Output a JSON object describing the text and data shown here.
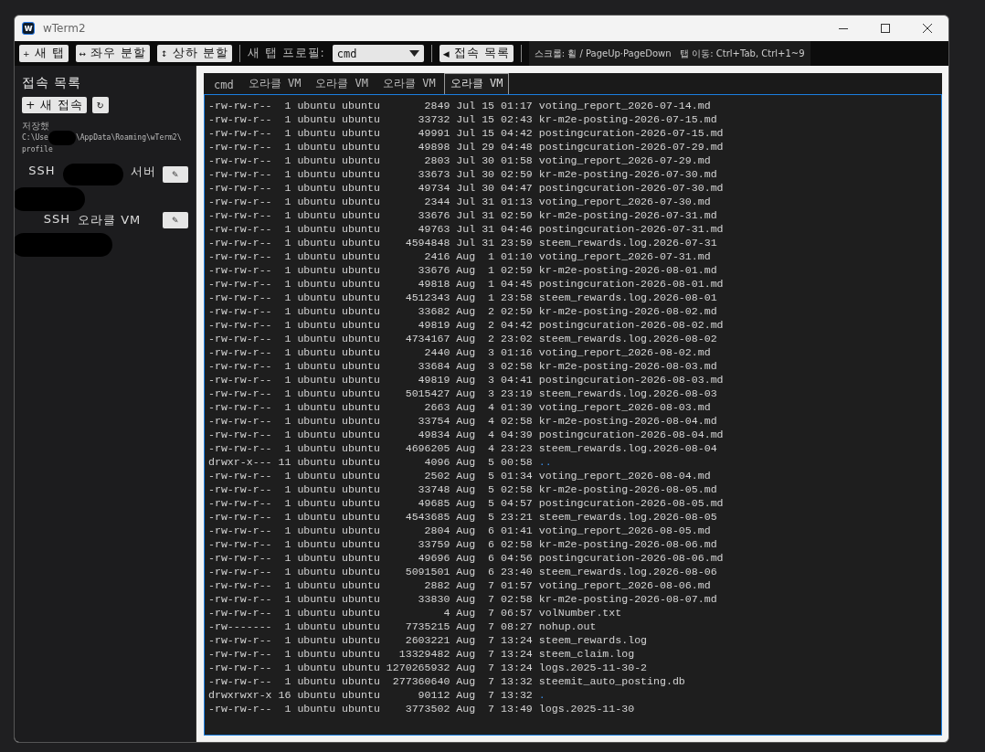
{
  "window": {
    "icon_letter": "w",
    "title": "wTerm2"
  },
  "toolbar": {
    "buttons": [
      {
        "icon": "+",
        "label": "새 탭"
      },
      {
        "icon": "↔",
        "label": "좌우 분할"
      },
      {
        "icon": "↕",
        "label": "상하 분할"
      }
    ],
    "profile_label": "새 탭 프로필:",
    "profile_value": "cmd",
    "connections_button": {
      "icon": "◀",
      "label": "접속 목록"
    },
    "hint": "스크롤: 휠 / PageUp·PageDown   탭 이동: Ctrl+Tab, Ctrl+1~9"
  },
  "sidebar": {
    "title": "접속 목록",
    "new_button": "+ 새 접속",
    "refresh_button": "↻",
    "saved_label": "저장했",
    "saved_path_parts": [
      "C:\\Use",
      "\\AppData\\Roaming\\wTerm2\\",
      "profile"
    ],
    "connections": [
      {
        "protocol": "SSH",
        "label": "서버",
        "redacted": true,
        "edit": "✎"
      },
      {
        "protocol": "SSH",
        "label": "오라클 VM",
        "redacted": false,
        "edit": "✎"
      }
    ]
  },
  "tabs": [
    {
      "label": "cmd",
      "selected": false
    },
    {
      "label": "오라클 VM",
      "selected": false
    },
    {
      "label": "오라클 VM",
      "selected": false
    },
    {
      "label": "오라클 VM",
      "selected": false
    },
    {
      "label": "오라클 VM",
      "selected": true
    }
  ],
  "terminal_lines": [
    {
      "info": "-rw-rw-r--  1 ubuntu ubuntu       2849 Jul 15 01:17",
      "name": "voting_report_2026-07-14.md",
      "kind": "file"
    },
    {
      "info": "-rw-rw-r--  1 ubuntu ubuntu      33732 Jul 15 02:43",
      "name": "kr-m2e-posting-2026-07-15.md",
      "kind": "file"
    },
    {
      "info": "-rw-rw-r--  1 ubuntu ubuntu      49991 Jul 15 04:42",
      "name": "postingcuration-2026-07-15.md",
      "kind": "file"
    },
    {
      "info": "-rw-rw-r--  1 ubuntu ubuntu      49898 Jul 29 04:48",
      "name": "postingcuration-2026-07-29.md",
      "kind": "file"
    },
    {
      "info": "-rw-rw-r--  1 ubuntu ubuntu       2803 Jul 30 01:58",
      "name": "voting_report_2026-07-29.md",
      "kind": "file"
    },
    {
      "info": "-rw-rw-r--  1 ubuntu ubuntu      33673 Jul 30 02:59",
      "name": "kr-m2e-posting-2026-07-30.md",
      "kind": "file"
    },
    {
      "info": "-rw-rw-r--  1 ubuntu ubuntu      49734 Jul 30 04:47",
      "name": "postingcuration-2026-07-30.md",
      "kind": "file"
    },
    {
      "info": "-rw-rw-r--  1 ubuntu ubuntu       2344 Jul 31 01:13",
      "name": "voting_report_2026-07-30.md",
      "kind": "file"
    },
    {
      "info": "-rw-rw-r--  1 ubuntu ubuntu      33676 Jul 31 02:59",
      "name": "kr-m2e-posting-2026-07-31.md",
      "kind": "file"
    },
    {
      "info": "-rw-rw-r--  1 ubuntu ubuntu      49763 Jul 31 04:46",
      "name": "postingcuration-2026-07-31.md",
      "kind": "file"
    },
    {
      "info": "-rw-rw-r--  1 ubuntu ubuntu    4594848 Jul 31 23:59",
      "name": "steem_rewards.log.2026-07-31",
      "kind": "file"
    },
    {
      "info": "-rw-rw-r--  1 ubuntu ubuntu       2416 Aug  1 01:10",
      "name": "voting_report_2026-07-31.md",
      "kind": "file"
    },
    {
      "info": "-rw-rw-r--  1 ubuntu ubuntu      33676 Aug  1 02:59",
      "name": "kr-m2e-posting-2026-08-01.md",
      "kind": "file"
    },
    {
      "info": "-rw-rw-r--  1 ubuntu ubuntu      49818 Aug  1 04:45",
      "name": "postingcuration-2026-08-01.md",
      "kind": "file"
    },
    {
      "info": "-rw-rw-r--  1 ubuntu ubuntu    4512343 Aug  1 23:58",
      "name": "steem_rewards.log.2026-08-01",
      "kind": "file"
    },
    {
      "info": "-rw-rw-r--  1 ubuntu ubuntu      33682 Aug  2 02:59",
      "name": "kr-m2e-posting-2026-08-02.md",
      "kind": "file"
    },
    {
      "info": "-rw-rw-r--  1 ubuntu ubuntu      49819 Aug  2 04:42",
      "name": "postingcuration-2026-08-02.md",
      "kind": "file"
    },
    {
      "info": "-rw-rw-r--  1 ubuntu ubuntu    4734167 Aug  2 23:02",
      "name": "steem_rewards.log.2026-08-02",
      "kind": "file"
    },
    {
      "info": "-rw-rw-r--  1 ubuntu ubuntu       2440 Aug  3 01:16",
      "name": "voting_report_2026-08-02.md",
      "kind": "file"
    },
    {
      "info": "-rw-rw-r--  1 ubuntu ubuntu      33684 Aug  3 02:58",
      "name": "kr-m2e-posting-2026-08-03.md",
      "kind": "file"
    },
    {
      "info": "-rw-rw-r--  1 ubuntu ubuntu      49819 Aug  3 04:41",
      "name": "postingcuration-2026-08-03.md",
      "kind": "file"
    },
    {
      "info": "-rw-rw-r--  1 ubuntu ubuntu    5015427 Aug  3 23:19",
      "name": "steem_rewards.log.2026-08-03",
      "kind": "file"
    },
    {
      "info": "-rw-rw-r--  1 ubuntu ubuntu       2663 Aug  4 01:39",
      "name": "voting_report_2026-08-03.md",
      "kind": "file"
    },
    {
      "info": "-rw-rw-r--  1 ubuntu ubuntu      33754 Aug  4 02:58",
      "name": "kr-m2e-posting-2026-08-04.md",
      "kind": "file"
    },
    {
      "info": "-rw-rw-r--  1 ubuntu ubuntu      49834 Aug  4 04:39",
      "name": "postingcuration-2026-08-04.md",
      "kind": "file"
    },
    {
      "info": "-rw-rw-r--  1 ubuntu ubuntu    4696205 Aug  4 23:23",
      "name": "steem_rewards.log.2026-08-04",
      "kind": "file"
    },
    {
      "info": "drwxr-x--- 11 ubuntu ubuntu       4096 Aug  5 00:58",
      "name": "..",
      "kind": "dir"
    },
    {
      "info": "-rw-rw-r--  1 ubuntu ubuntu       2502 Aug  5 01:34",
      "name": "voting_report_2026-08-04.md",
      "kind": "file"
    },
    {
      "info": "-rw-rw-r--  1 ubuntu ubuntu      33748 Aug  5 02:58",
      "name": "kr-m2e-posting-2026-08-05.md",
      "kind": "file"
    },
    {
      "info": "-rw-rw-r--  1 ubuntu ubuntu      49685 Aug  5 04:57",
      "name": "postingcuration-2026-08-05.md",
      "kind": "file"
    },
    {
      "info": "-rw-rw-r--  1 ubuntu ubuntu    4543685 Aug  5 23:21",
      "name": "steem_rewards.log.2026-08-05",
      "kind": "file"
    },
    {
      "info": "-rw-rw-r--  1 ubuntu ubuntu       2804 Aug  6 01:41",
      "name": "voting_report_2026-08-05.md",
      "kind": "file"
    },
    {
      "info": "-rw-rw-r--  1 ubuntu ubuntu      33759 Aug  6 02:58",
      "name": "kr-m2e-posting-2026-08-06.md",
      "kind": "file"
    },
    {
      "info": "-rw-rw-r--  1 ubuntu ubuntu      49696 Aug  6 04:56",
      "name": "postingcuration-2026-08-06.md",
      "kind": "file"
    },
    {
      "info": "-rw-rw-r--  1 ubuntu ubuntu    5091501 Aug  6 23:40",
      "name": "steem_rewards.log.2026-08-06",
      "kind": "file"
    },
    {
      "info": "-rw-rw-r--  1 ubuntu ubuntu       2882 Aug  7 01:57",
      "name": "voting_report_2026-08-06.md",
      "kind": "file"
    },
    {
      "info": "-rw-rw-r--  1 ubuntu ubuntu      33830 Aug  7 02:58",
      "name": "kr-m2e-posting-2026-08-07.md",
      "kind": "file"
    },
    {
      "info": "-rw-rw-r--  1 ubuntu ubuntu          4 Aug  7 06:57",
      "name": "volNumber.txt",
      "kind": "file"
    },
    {
      "info": "-rw-------  1 ubuntu ubuntu    7735215 Aug  7 08:27",
      "name": "nohup.out",
      "kind": "file"
    },
    {
      "info": "-rw-rw-r--  1 ubuntu ubuntu    2603221 Aug  7 13:24",
      "name": "steem_rewards.log",
      "kind": "file"
    },
    {
      "info": "-rw-rw-r--  1 ubuntu ubuntu   13329482 Aug  7 13:24",
      "name": "steem_claim.log",
      "kind": "file"
    },
    {
      "info": "-rw-rw-r--  1 ubuntu ubuntu 1270265932 Aug  7 13:24",
      "name": "logs.2025-11-30-2",
      "kind": "file"
    },
    {
      "info": "-rw-rw-r--  1 ubuntu ubuntu  277360640 Aug  7 13:32",
      "name": "steemit_auto_posting.db",
      "kind": "file"
    },
    {
      "info": "drwxrwxr-x 16 ubuntu ubuntu      90112 Aug  7 13:32",
      "name": ".",
      "kind": "dir"
    },
    {
      "info": "-rw-rw-r--  1 ubuntu ubuntu    3773502 Aug  7 13:49",
      "name": "logs.2025-11-30",
      "kind": "file"
    }
  ]
}
